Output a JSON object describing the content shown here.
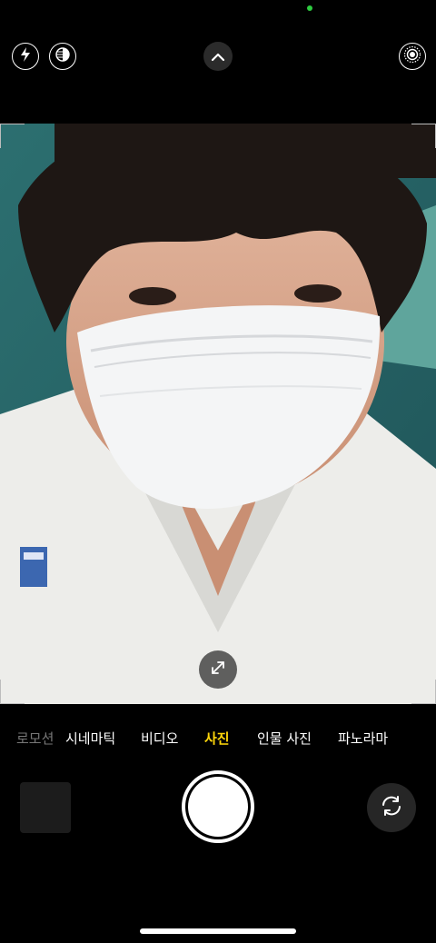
{
  "top_bar": {
    "icons": [
      "flash-icon",
      "night-mode-icon",
      "chevron-up-icon",
      "live-photo-icon"
    ]
  },
  "modes": {
    "items": [
      {
        "label": "로모션",
        "state": "partial"
      },
      {
        "label": "시네마틱",
        "state": "normal"
      },
      {
        "label": "비디오",
        "state": "normal"
      },
      {
        "label": "사진",
        "state": "active"
      },
      {
        "label": "인물 사진",
        "state": "normal"
      },
      {
        "label": "파노라마",
        "state": "normal"
      }
    ]
  },
  "colors": {
    "active_mode": "#ffd60a",
    "status_dot": "#2ecc40",
    "background": "#000000"
  },
  "viewfinder": {
    "content": "camera-preview"
  }
}
